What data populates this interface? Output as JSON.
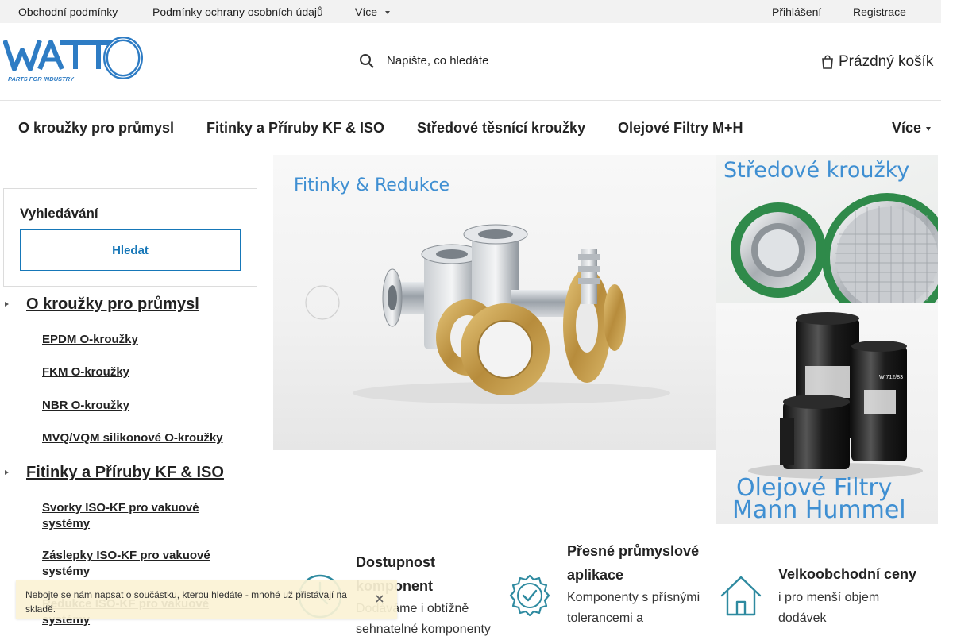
{
  "topbar": {
    "links": [
      "Obchodní podmínky",
      "Podmínky ochrany osobních údajů"
    ],
    "more": "Více",
    "login": "Přihlášení",
    "register": "Registrace"
  },
  "header": {
    "logo_text": "WATTO",
    "logo_tagline": "PARTS FOR INDUSTRY",
    "search_placeholder": "Napište, co hledáte",
    "cart_label": "Prázdný košík"
  },
  "nav": {
    "items": [
      "O kroužky pro průmysl",
      "Fitinky a Příruby KF & ISO",
      "Středové těsnící kroužky",
      "Olejové Filtry M+H"
    ],
    "more": "Více"
  },
  "sidebar": {
    "search_title": "Vyhledávání",
    "search_button": "Hledat",
    "categories": [
      {
        "name": "O kroužky pro průmysl",
        "subs": [
          "EPDM O-kroužky",
          "FKM O-kroužky",
          "NBR O-kroužky",
          "MVQ/VQM silikonové O-kroužky"
        ]
      },
      {
        "name": "Fitinky a Příruby KF & ISO",
        "subs": [
          "Svorky ISO-KF pro vakuové systémy",
          "Záslepky ISO-KF pro vakuové systémy",
          "Redukce ISO-KF pro vakuové systémy"
        ]
      }
    ]
  },
  "banners": {
    "main_title": "Fitinky & Redukce",
    "right1_title": "Středové kroužky",
    "right2_title_line1": "Olejové Filtry",
    "right2_title_line2": "Mann Hummel",
    "filter_label": "W 712/83"
  },
  "features": [
    {
      "title": "Dostupnost komponent",
      "text": "Dodáváme i obtížně sehnatelné komponenty"
    },
    {
      "title": "Přesné průmyslové aplikace",
      "text": "Komponenty s přísnými tolerancemi a"
    },
    {
      "title": "Velkoobchodní ceny",
      "text": "i pro menší objem dodávek"
    }
  ],
  "infobar": {
    "text": "Nebojte se nám napsat o součástku, kterou hledáte - mnohé už přistávají na skladě."
  },
  "colors": {
    "accent": "#1677b8",
    "logo_blue": "#2e7cc4",
    "banner_text": "#3f8fd2",
    "icon_teal": "#2e8aa0",
    "infobar_bg": "#fbf3d5"
  }
}
